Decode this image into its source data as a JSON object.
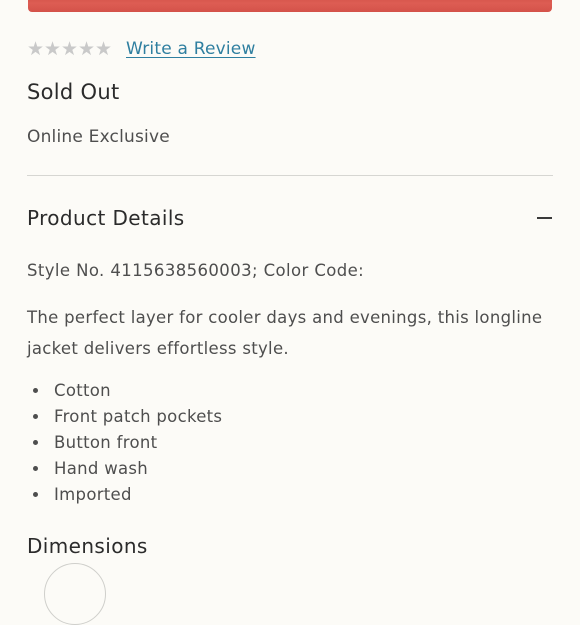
{
  "product": {
    "image_color": "#d9564d"
  },
  "rating": {
    "stars_filled": 0,
    "stars_total": 5,
    "star_glyph": "★",
    "write_review_label": "Write a Review"
  },
  "status": {
    "availability": "Sold Out",
    "exclusivity": "Online Exclusive"
  },
  "details": {
    "title": "Product Details",
    "style_line": "Style No. 4115638560003; Color Code:",
    "description": "The perfect layer for cooler days and evenings, this longline jacket delivers effortless style.",
    "features": [
      "Cotton",
      "Front patch pockets",
      "Button front",
      "Hand wash",
      "Imported"
    ]
  },
  "dimensions": {
    "title": "Dimensions"
  },
  "colors": {
    "link": "#2f7fa0",
    "star_empty": "#c9c9c9",
    "background": "#fcfbf7"
  }
}
